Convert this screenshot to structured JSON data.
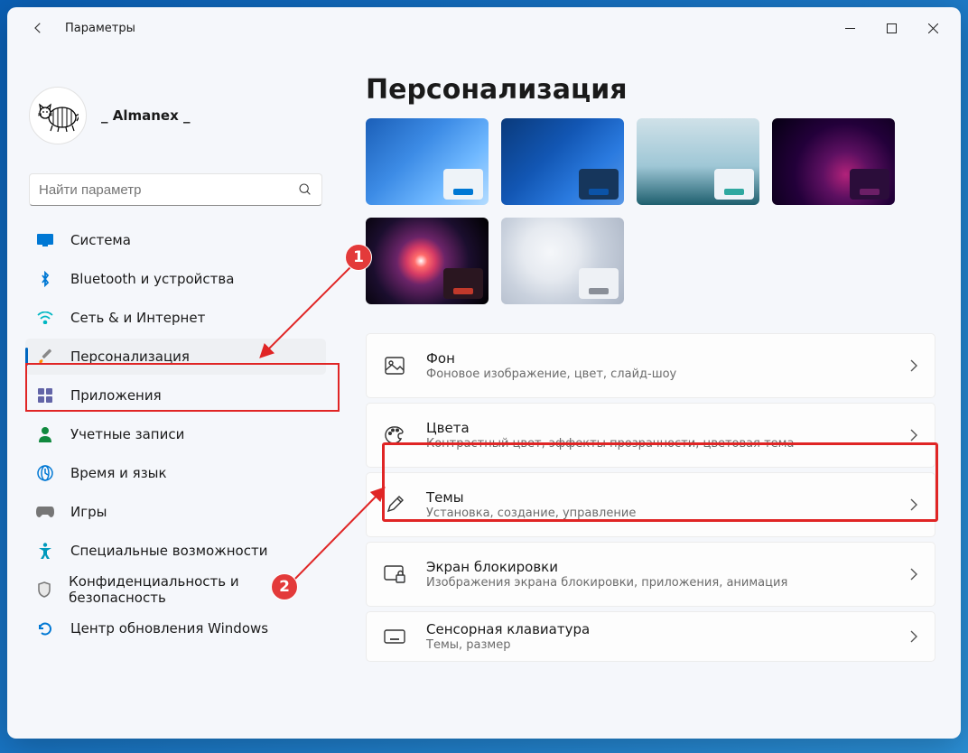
{
  "window": {
    "title": "Параметры"
  },
  "profile": {
    "name": "_ Almanex _"
  },
  "search": {
    "placeholder": "Найти параметр"
  },
  "sidebar": {
    "items": [
      {
        "label": "Система",
        "icon": "display-icon",
        "color": "#0078d4"
      },
      {
        "label": "Bluetooth и устройства",
        "icon": "bluetooth-icon",
        "color": "#0078d4"
      },
      {
        "label": "Сеть & и Интернет",
        "icon": "wifi-icon",
        "color": "#00b7c3"
      },
      {
        "label": "Персонализация",
        "icon": "brush-icon",
        "color": "#ff8c00",
        "selected": true
      },
      {
        "label": "Приложения",
        "icon": "apps-icon",
        "color": "#6264a7"
      },
      {
        "label": "Учетные записи",
        "icon": "person-icon",
        "color": "#10893e"
      },
      {
        "label": "Время и язык",
        "icon": "clock-globe-icon",
        "color": "#0078d4"
      },
      {
        "label": "Игры",
        "icon": "gamepad-icon",
        "color": "#767676"
      },
      {
        "label": "Специальные возможности",
        "icon": "accessibility-icon",
        "color": "#0099bc"
      },
      {
        "label": "Конфиденциальность и безопасность",
        "icon": "shield-icon",
        "color": "#767676"
      },
      {
        "label": "Центр обновления Windows",
        "icon": "update-icon",
        "color": "#0078d4"
      }
    ]
  },
  "page": {
    "title": "Персонализация"
  },
  "themes": [
    {
      "bg": "linear-gradient(135deg,#1b5fb8 0%,#3d8ce6 40%,#6fb8ff 70%,#b5dcff 100%)",
      "chip_bg": "#eef3f8",
      "bar": "#0078d4"
    },
    {
      "bg": "linear-gradient(135deg,#0a3a7b 0%,#1256b3 40%,#2a7adf 70%,#5897e6 100%)",
      "chip_bg": "#16365c",
      "bar": "#0b53a8"
    },
    {
      "bg": "linear-gradient(180deg,#cfe1e8 0%,#9fc7d6 55%,#1e5f6e 100%)",
      "chip_bg": "#eef3f8",
      "bar": "#2fa8a0"
    },
    {
      "bg": "radial-gradient(circle at 60% 65%,#b2227a 0%,#5d1061 25%,#23003a 55%,#050012 100%)",
      "chip_bg": "#2b0d3a",
      "bar": "#6b1f66"
    },
    {
      "bg": "radial-gradient(circle at 45% 50%,#ffffff 0%,#ff6a6a 8%,#d43a65 18%,#6b2468 30%,#1b0e2e 60%,#000 100%)",
      "chip_bg": "#2a1620",
      "bar": "#c0392b"
    },
    {
      "bg": "radial-gradient(circle at 40% 40%,#f5f7fa 0%,#e6eaf0 30%,#c9d1dd 55%,#aab4c4 100%)",
      "chip_bg": "#eef1f5",
      "bar": "#8a8f98"
    }
  ],
  "settings": [
    {
      "icon": "image-icon",
      "title": "Фон",
      "sub": "Фоновое изображение, цвет, слайд-шоу"
    },
    {
      "icon": "palette-icon",
      "title": "Цвета",
      "sub": "Контрастный цвет, эффекты прозрачности, цветовая тема"
    },
    {
      "icon": "pen-icon",
      "title": "Темы",
      "sub": "Установка, создание, управление"
    },
    {
      "icon": "lockscreen-icon",
      "title": "Экран блокировки",
      "sub": "Изображения экрана блокировки, приложения, анимация"
    },
    {
      "icon": "keyboard-icon",
      "title": "Сенсорная клавиатура",
      "sub": "Темы, размер"
    }
  ],
  "annotations": {
    "badge1": "1",
    "badge2": "2"
  }
}
